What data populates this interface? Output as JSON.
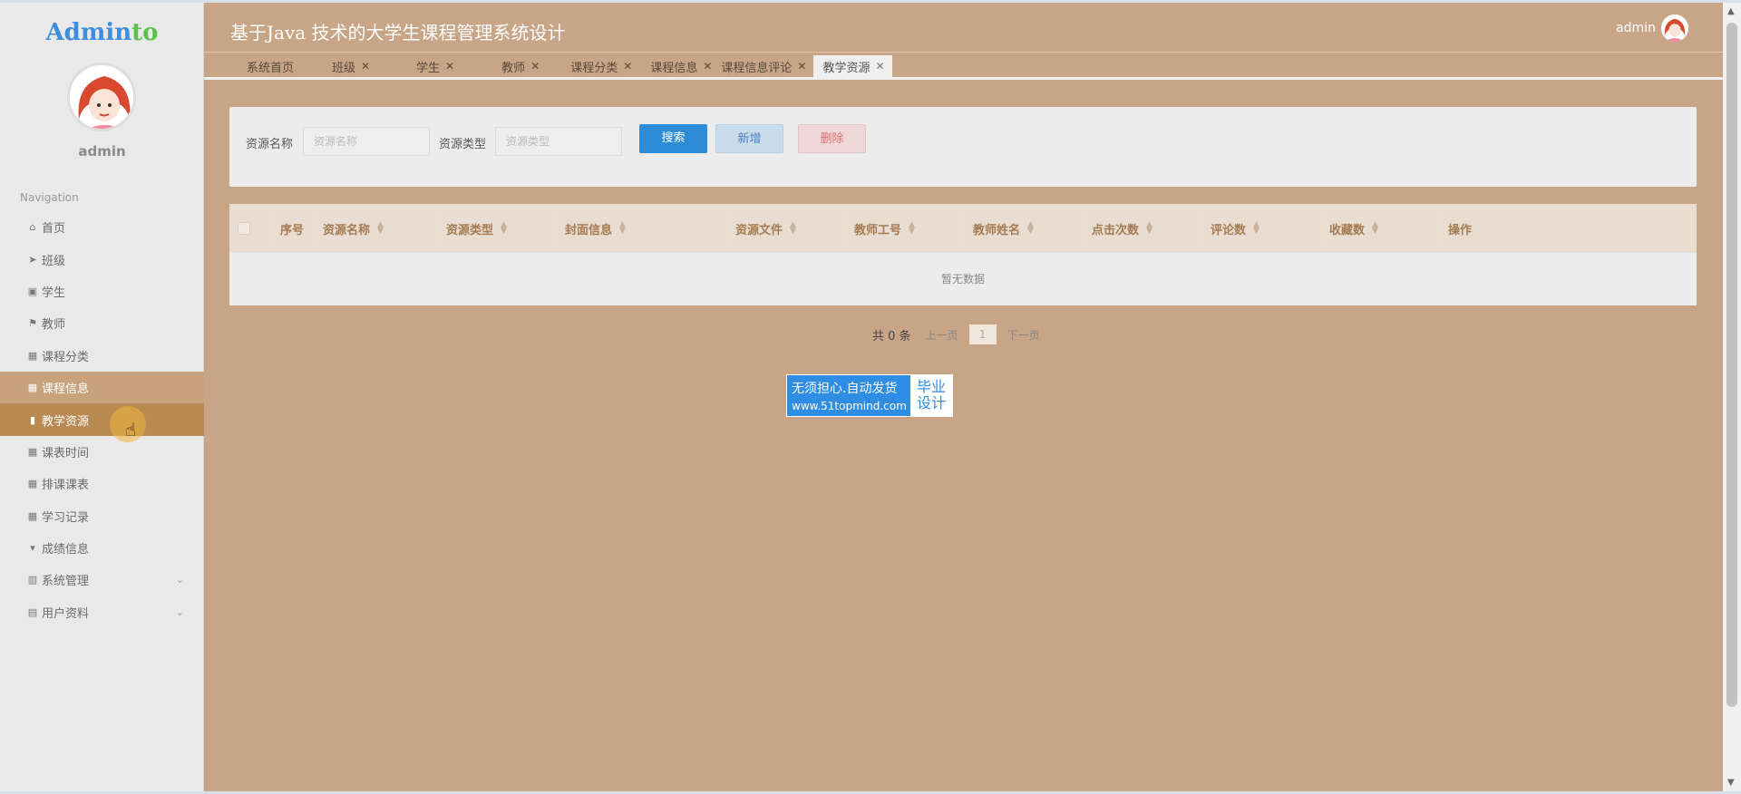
{
  "brand": {
    "part1": "Admin",
    "part2": "to"
  },
  "sidebar": {
    "username": "admin",
    "nav_title": "Navigation",
    "items": [
      {
        "label": "首页",
        "icon": "home-icon",
        "glyph": "⌂"
      },
      {
        "label": "班级",
        "icon": "paper-plane-icon",
        "glyph": "➤"
      },
      {
        "label": "学生",
        "icon": "clipboard-icon",
        "glyph": "▣"
      },
      {
        "label": "教师",
        "icon": "flag-icon",
        "glyph": "⚑"
      },
      {
        "label": "课程分类",
        "icon": "grid-icon",
        "glyph": "▦"
      },
      {
        "label": "课程信息",
        "icon": "grid-icon",
        "glyph": "▦"
      },
      {
        "label": "教学资源",
        "icon": "bar-chart-icon",
        "glyph": "▮"
      },
      {
        "label": "课表时间",
        "icon": "grid-icon",
        "glyph": "▦"
      },
      {
        "label": "排课课表",
        "icon": "grid-icon",
        "glyph": "▦"
      },
      {
        "label": "学习记录",
        "icon": "grid-icon",
        "glyph": "▦"
      },
      {
        "label": "成绩信息",
        "icon": "trophy-icon",
        "glyph": "▾"
      },
      {
        "label": "系统管理",
        "icon": "library-icon",
        "glyph": "▥"
      },
      {
        "label": "用户资料",
        "icon": "id-card-icon",
        "glyph": "▤"
      }
    ]
  },
  "header": {
    "title": "基于Java 技术的大学生课程管理系统设计",
    "user": "admin"
  },
  "tabs": [
    {
      "label": "系统首页"
    },
    {
      "label": "班级"
    },
    {
      "label": "学生"
    },
    {
      "label": "教师"
    },
    {
      "label": "课程分类"
    },
    {
      "label": "课程信息"
    },
    {
      "label": "课程信息评论"
    },
    {
      "label": "教学资源"
    }
  ],
  "search": {
    "name_label": "资源名称",
    "name_placeholder": "资源名称",
    "type_label": "资源类型",
    "type_placeholder": "资源类型",
    "search_btn": "搜索",
    "add_btn": "新增",
    "delete_btn": "删除"
  },
  "table": {
    "columns": [
      "序号",
      "资源名称",
      "资源类型",
      "封面信息",
      "资源文件",
      "教师工号",
      "教师姓名",
      "点击次数",
      "评论数",
      "收藏数",
      "操作"
    ],
    "empty_text": "暂无数据"
  },
  "pagination": {
    "total": "共 0 条",
    "prev": "上一页",
    "page": "1",
    "next": "下一页"
  },
  "watermark": {
    "line1": "无须担心.自动发货",
    "line2": "www.51topmind.com",
    "right1": "毕业",
    "right2": "设计"
  }
}
